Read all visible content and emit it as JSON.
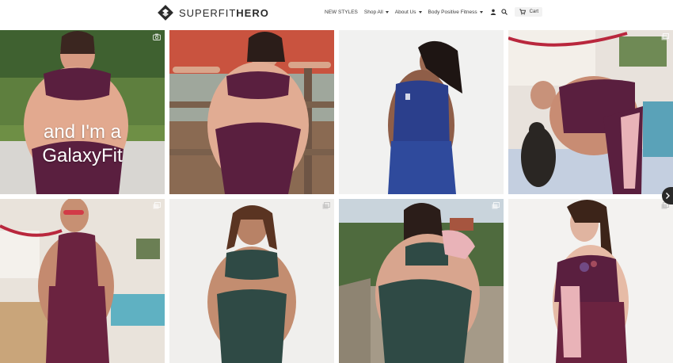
{
  "brand": {
    "name_light": "SUPERFIT",
    "name_bold": "HERO"
  },
  "nav": {
    "items": [
      {
        "label": "NEW STYLES",
        "has_caret": false
      },
      {
        "label": "Shop All",
        "has_caret": true
      },
      {
        "label": "About Us",
        "has_caret": true
      },
      {
        "label": "Body Positive Fitness",
        "has_caret": true
      }
    ],
    "cart_label": "Cart",
    "icons": [
      "user-icon",
      "search-icon",
      "cart-icon"
    ]
  },
  "gallery": {
    "tiles": [
      {
        "name": "photo-1",
        "overlay": [
          "and I'm a",
          "GalaxyFit"
        ],
        "badge": "camera-icon"
      },
      {
        "name": "photo-2"
      },
      {
        "name": "photo-3"
      },
      {
        "name": "photo-4",
        "badge": "multi-image-icon"
      },
      {
        "name": "photo-5",
        "badge": "multi-image-icon"
      },
      {
        "name": "photo-6",
        "badge": "multi-image-icon"
      },
      {
        "name": "photo-7",
        "badge": "multi-image-icon"
      },
      {
        "name": "photo-8",
        "badge": "multi-image-icon"
      }
    ],
    "next_label": "›"
  },
  "colors": {
    "plum": "#5a1f3f",
    "burgundy": "#6b2340",
    "navy": "#2b3f8c",
    "forest": "#2f4a45",
    "blush": "#e9b3b8"
  }
}
